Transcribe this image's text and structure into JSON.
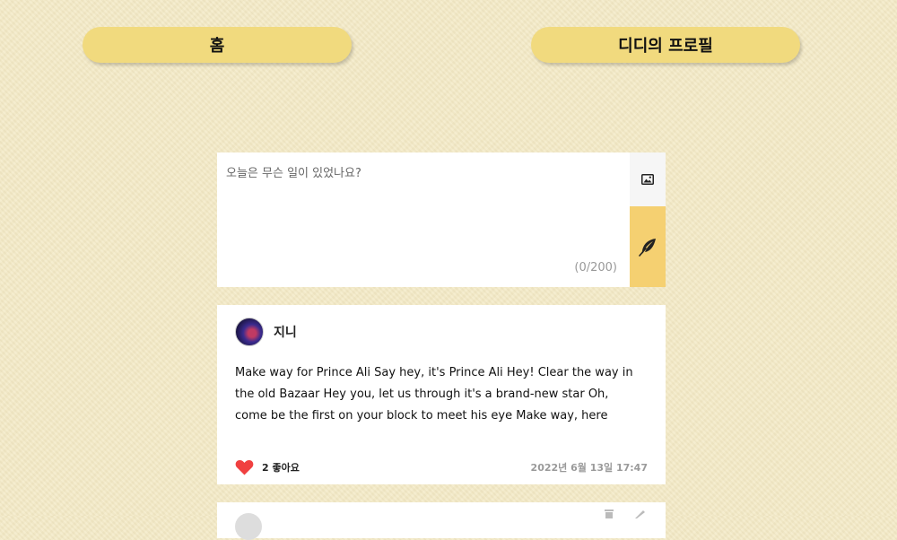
{
  "nav": {
    "home_label": "홈",
    "profile_label": "디디의 프로필"
  },
  "composer": {
    "placeholder": "오늘은 무슨 일이 있었나요?",
    "value": "",
    "char_count": "(0/200)",
    "image_icon": "image-icon",
    "submit_icon": "feather-icon"
  },
  "posts": [
    {
      "author": "지니",
      "body": "Make way for Prince Ali Say hey, it's Prince Ali Hey! Clear the way in the old Bazaar Hey you, let us through it's a brand-new star Oh, come be the first on your block to meet his eye Make way, here",
      "likes": "2 좋아요",
      "date": "2022년 6월 13일 17:47",
      "like_icon": "heart-icon"
    }
  ],
  "colors": {
    "background": "#f3e9c4",
    "nav_button": "#f1da7e",
    "submit": "#f5d071",
    "heart": "#f04040"
  }
}
